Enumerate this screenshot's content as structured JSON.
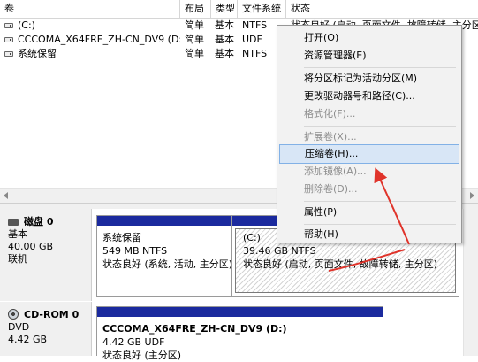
{
  "columns": [
    "卷",
    "布局",
    "类型",
    "文件系统",
    "状态"
  ],
  "volumes": [
    {
      "name": "(C:)",
      "layout": "简单",
      "type": "基本",
      "fs": "NTFS",
      "status": "状态良好 (启动, 页面文件, 故障转储, 主分区"
    },
    {
      "name": "CCCOMA_X64FRE_ZH-CN_DV9 (D:)",
      "layout": "简单",
      "type": "基本",
      "fs": "UDF",
      "status": ""
    },
    {
      "name": "系统保留",
      "layout": "简单",
      "type": "基本",
      "fs": "NTFS",
      "status": ""
    }
  ],
  "disks": [
    {
      "title": "磁盘 0",
      "kind": "基本",
      "size": "40.00 GB",
      "state": "联机",
      "partitions": [
        {
          "name": "系统保留",
          "size": "549 MB NTFS",
          "status": "状态良好 (系统, 活动, 主分区)"
        },
        {
          "name": "(C:)",
          "size": "39.46 GB NTFS",
          "status": "状态良好 (启动, 页面文件, 故障转储, 主分区)"
        }
      ]
    },
    {
      "title": "CD-ROM 0",
      "kind": "DVD",
      "size": "4.42 GB",
      "state": "",
      "partitions": [
        {
          "name": "CCCOMA_X64FRE_ZH-CN_DV9  (D:)",
          "size": "4.42 GB UDF",
          "status": "状态良好 (主分区)"
        }
      ]
    }
  ],
  "context_menu": [
    {
      "label": "打开(O)",
      "enabled": true
    },
    {
      "label": "资源管理器(E)",
      "enabled": true
    },
    {
      "label": "将分区标记为活动分区(M)",
      "enabled": true
    },
    {
      "label": "更改驱动器号和路径(C)...",
      "enabled": true
    },
    {
      "label": "格式化(F)...",
      "enabled": false
    },
    {
      "label": "扩展卷(X)...",
      "enabled": false
    },
    {
      "label": "压缩卷(H)...",
      "enabled": true,
      "highlighted": true
    },
    {
      "label": "添加镜像(A)...",
      "enabled": false
    },
    {
      "label": "删除卷(D)...",
      "enabled": false
    },
    {
      "label": "属性(P)",
      "enabled": true
    },
    {
      "label": "帮助(H)",
      "enabled": true
    }
  ],
  "colors": {
    "partition_bar": "#1b2a9e",
    "menu_highlight": "#d8e6f6",
    "annotation": "#e0342b"
  }
}
